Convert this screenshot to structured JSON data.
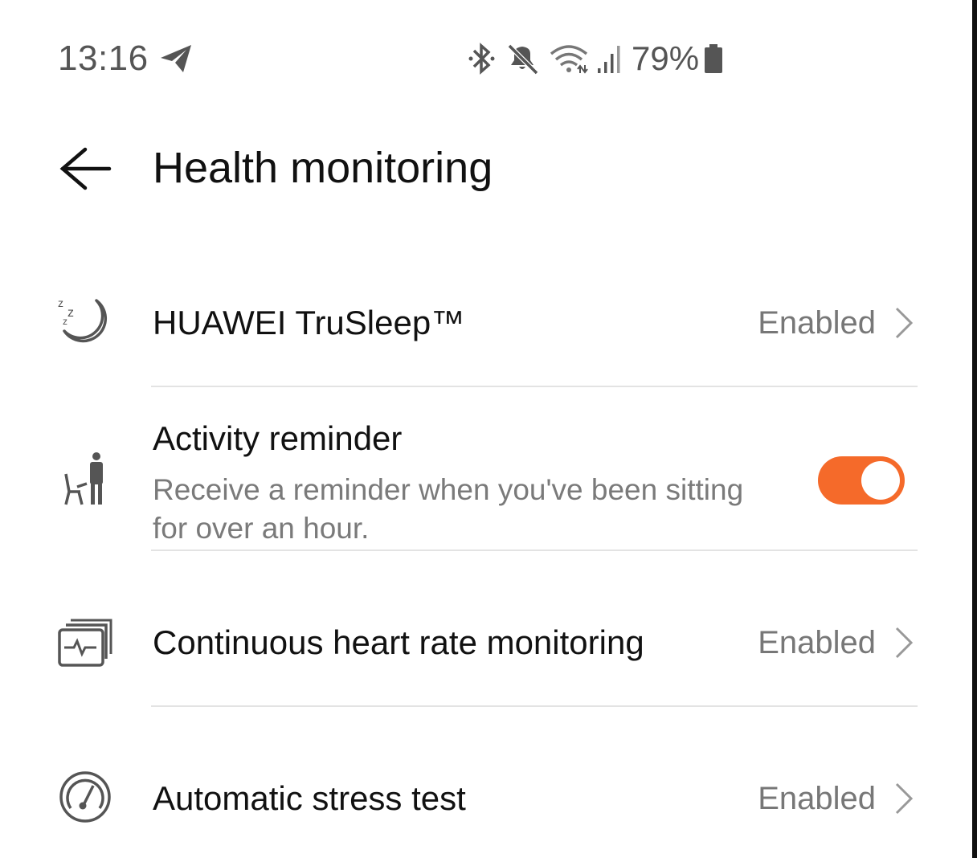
{
  "status_bar": {
    "time": "13:16",
    "battery": "79%",
    "icons": [
      "telegram-icon",
      "bluetooth-icon",
      "mute-icon",
      "wifi-icon",
      "signal-icon",
      "battery-icon"
    ]
  },
  "header": {
    "title": "Health monitoring",
    "back_icon": "arrow-left-icon"
  },
  "settings": [
    {
      "icon": "sleep-moon-icon",
      "label": "HUAWEI TruSleep™",
      "value": "Enabled"
    },
    {
      "icon": "person-sitting-icon",
      "label": "Activity reminder",
      "description": "Receive a reminder when you've been sitting for over an hour.",
      "toggle": true
    },
    {
      "icon": "heart-rate-monitor-icon",
      "label": "Continuous heart rate monitoring",
      "value": "Enabled"
    },
    {
      "icon": "stress-gauge-icon",
      "label": "Automatic stress test",
      "value": "Enabled"
    }
  ],
  "colors": {
    "accent": "#f56a2a",
    "text_primary": "#111111",
    "text_secondary": "#777777",
    "divider": "#e3e3e3"
  }
}
